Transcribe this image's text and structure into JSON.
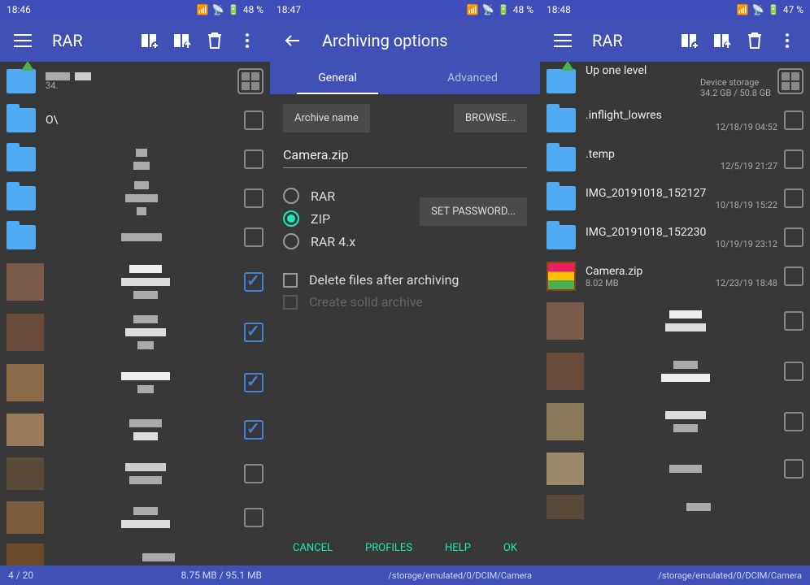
{
  "panel1": {
    "status": {
      "time": "18:46",
      "battery": "48"
    },
    "title": "RAR",
    "up": {
      "label": "",
      "sub": "34."
    },
    "rows": [
      {
        "title": "O\\",
        "checked": false
      },
      {
        "title": "",
        "checked": false
      },
      {
        "title": "",
        "checked": false
      },
      {
        "title": "",
        "checked": false
      }
    ],
    "footer_left": "4 / 20",
    "footer_right": "8.75 MB / 95.1 MB"
  },
  "panel2": {
    "status": {
      "time": "18:47",
      "battery": "48"
    },
    "title": "Archiving options",
    "tabs": {
      "general": "General",
      "advanced": "Advanced"
    },
    "archive_name_label": "Archive name",
    "browse": "BROWSE...",
    "filename": "Camera.zip",
    "formats": {
      "rar": "RAR",
      "zip": "ZIP",
      "rar4x": "RAR 4.x"
    },
    "set_password": "SET PASSWORD...",
    "delete_after": "Delete files after archiving",
    "solid": "Create solid archive",
    "actions": {
      "cancel": "CANCEL",
      "profiles": "PROFILES",
      "help": "HELP",
      "ok": "OK"
    },
    "footer_path": "/storage/emulated/0/DCIM/Camera"
  },
  "panel3": {
    "status": {
      "time": "18:48",
      "battery": "47"
    },
    "title": "RAR",
    "up": {
      "label": "Up one level",
      "storage_label": "Device storage",
      "storage": "34.2 GB / 50.8 GB"
    },
    "items": [
      {
        "name": ".inflight_lowres",
        "date": "12/18/19 04:52",
        "type": "folder"
      },
      {
        "name": ".temp",
        "date": "12/5/19 21:27",
        "type": "folder"
      },
      {
        "name": "IMG_20191018_152127",
        "date": "10/18/19 15:22",
        "type": "folder"
      },
      {
        "name": "IMG_20191018_152230",
        "date": "10/19/19 23:12",
        "type": "folder"
      },
      {
        "name": "Camera.zip",
        "size": "8.02 MB",
        "date": "12/23/19 18:48",
        "type": "archive"
      }
    ],
    "footer_path": "/storage/emulated/0/DCIM/Camera"
  }
}
